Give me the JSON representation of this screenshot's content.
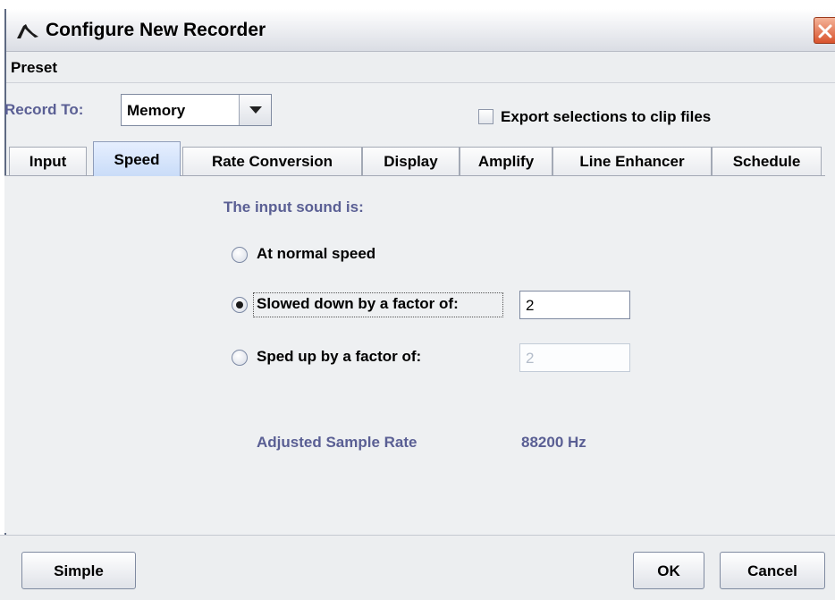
{
  "window": {
    "title": "Configure New Recorder"
  },
  "menu": {
    "preset": "Preset"
  },
  "record_to": {
    "label": "Record To:",
    "value": "Memory"
  },
  "export": {
    "label": "Export selections to clip files",
    "checked": false
  },
  "tabs": [
    {
      "label": "Input",
      "active": false
    },
    {
      "label": "Speed",
      "active": true
    },
    {
      "label": "Rate Conversion",
      "active": false
    },
    {
      "label": "Display",
      "active": false
    },
    {
      "label": "Amplify",
      "active": false
    },
    {
      "label": "Line Enhancer",
      "active": false
    },
    {
      "label": "Schedule",
      "active": false
    }
  ],
  "speed": {
    "section_title": "The input sound is:",
    "options": [
      {
        "label": "At normal speed",
        "selected": false
      },
      {
        "label": "Slowed down by a factor of:",
        "selected": true,
        "factor": "2",
        "enabled": true
      },
      {
        "label": "Sped up by a factor of:",
        "selected": false,
        "factor": "2",
        "enabled": false
      }
    ],
    "adjusted_label": "Adjusted Sample Rate",
    "adjusted_value": "88200 Hz"
  },
  "buttons": {
    "simple": "Simple",
    "ok": "OK",
    "cancel": "Cancel"
  },
  "colors": {
    "accent_label": "#5a5f94",
    "active_tab": "#c9dcf8",
    "close_button": "#d9532d"
  }
}
